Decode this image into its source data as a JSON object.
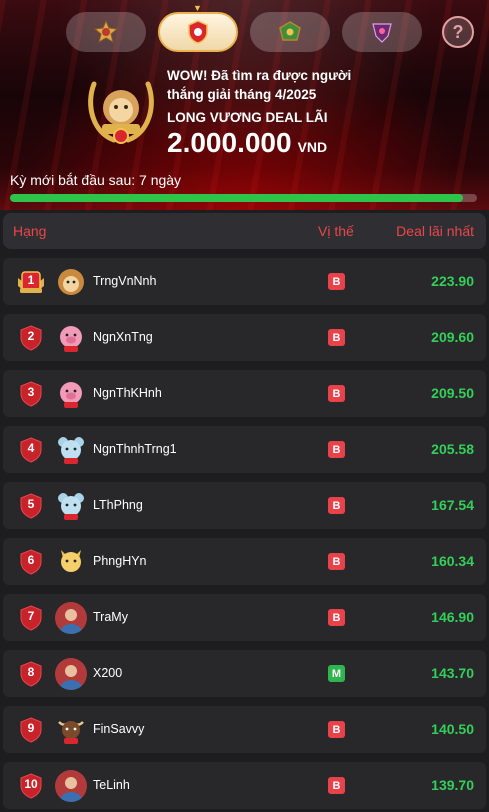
{
  "tabs": [
    {
      "name": "tab-medal",
      "icon": "medal-icon",
      "active": false
    },
    {
      "name": "tab-shield",
      "icon": "shield-icon",
      "active": true
    },
    {
      "name": "tab-dragon",
      "icon": "dragon-icon",
      "active": false
    },
    {
      "name": "tab-crest",
      "icon": "crest-icon",
      "active": false
    }
  ],
  "help_label": "?",
  "winner": {
    "line1": "WOW! Đã tìm ra được người",
    "line2": "thắng giải tháng 4/2025",
    "prize_name": "LONG VƯƠNG DEAL LÃI",
    "amount": "2.000.000",
    "currency": "VND"
  },
  "period_text": "Kỳ mới bắt đầu sau: 7 ngày",
  "period_progress_percent": 97,
  "table": {
    "col_rank": "Hạng",
    "col_position": "Vị thế",
    "col_deal": "Deal lãi nhất"
  },
  "rows": [
    {
      "rank": "1",
      "name": "TrngVnNnh",
      "pos": "B",
      "deal": "223.90",
      "avatar": "lion-avatar"
    },
    {
      "rank": "2",
      "name": "NgnXnTng",
      "pos": "B",
      "deal": "209.60",
      "avatar": "pig-avatar"
    },
    {
      "rank": "3",
      "name": "NgnThKHnh",
      "pos": "B",
      "deal": "209.50",
      "avatar": "pig-avatar"
    },
    {
      "rank": "4",
      "name": "NgnThnhTrng1",
      "pos": "B",
      "deal": "205.58",
      "avatar": "mouse-avatar"
    },
    {
      "rank": "5",
      "name": "LThPhng",
      "pos": "B",
      "deal": "167.54",
      "avatar": "mouse-avatar"
    },
    {
      "rank": "6",
      "name": "PhngHYn",
      "pos": "B",
      "deal": "160.34",
      "avatar": "cat-avatar"
    },
    {
      "rank": "7",
      "name": "TraMy",
      "pos": "B",
      "deal": "146.90",
      "avatar": "photo-avatar"
    },
    {
      "rank": "8",
      "name": "X200",
      "pos": "M",
      "deal": "143.70",
      "avatar": "photo-avatar"
    },
    {
      "rank": "9",
      "name": "FinSavvy",
      "pos": "B",
      "deal": "140.50",
      "avatar": "buffalo-avatar"
    },
    {
      "rank": "10",
      "name": "TeLinh",
      "pos": "B",
      "deal": "139.70",
      "avatar": "photo-avatar"
    }
  ],
  "colors": {
    "accent_red": "#e8464b",
    "deal_green": "#33cf5a",
    "buy_green": "#2fb54f",
    "sell_red": "#e8434a"
  }
}
